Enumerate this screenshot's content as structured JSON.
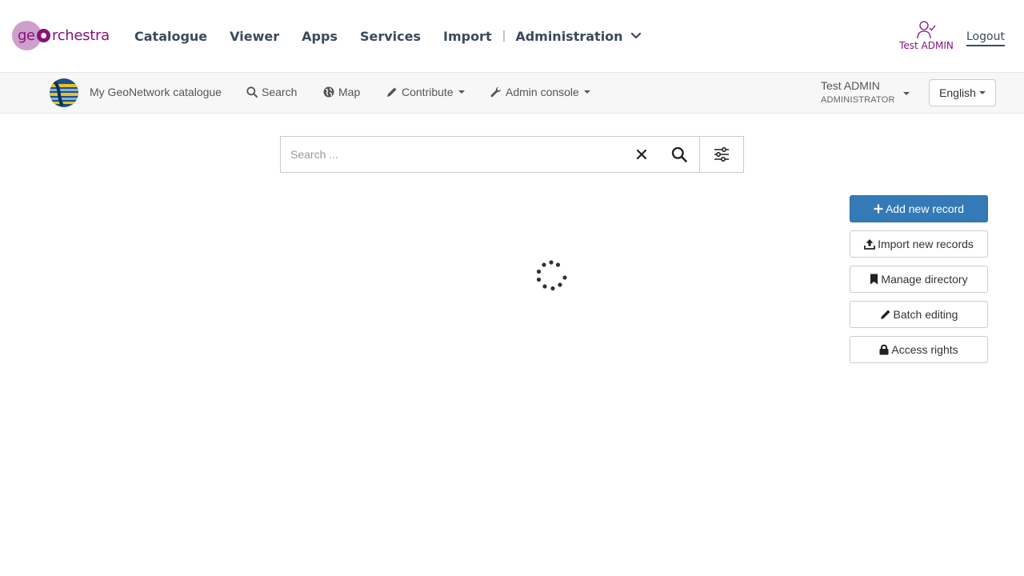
{
  "header": {
    "logo": {
      "part1": "ge",
      "part2": "rchestra"
    },
    "nav": [
      {
        "label": "Catalogue"
      },
      {
        "label": "Viewer"
      },
      {
        "label": "Apps"
      },
      {
        "label": "Services"
      },
      {
        "label": "Import"
      }
    ],
    "separator": "|",
    "admin_label": "Administration",
    "user_name": "Test ADMIN",
    "logout_label": "Logout",
    "brand_color": "#85127e"
  },
  "gn_nav": {
    "catalogue_title": "My GeoNetwork catalogue",
    "search_label": "Search",
    "map_label": "Map",
    "contribute_label": "Contribute",
    "admin_console_label": "Admin console",
    "user_name": "Test ADMIN",
    "user_role": "ADMINISTRATOR",
    "language": "English"
  },
  "search": {
    "placeholder": "Search ..."
  },
  "actions": {
    "add_new_record": "Add new record",
    "import_new_records": "Import new records",
    "manage_directory": "Manage directory",
    "batch_editing": "Batch editing",
    "access_rights": "Access rights",
    "primary_color": "#337ab7"
  },
  "icons": {
    "user": "user-check-icon",
    "search": "search-icon",
    "map": "globe-icon",
    "contribute": "pencil-icon",
    "admin": "wrench-icon",
    "clear": "close-icon",
    "filter": "sliders-icon",
    "add": "plus-icon",
    "import": "upload-icon",
    "directory": "bookmark-icon",
    "batch": "pencil-icon",
    "access": "lock-icon",
    "loading": "spinner-icon"
  }
}
